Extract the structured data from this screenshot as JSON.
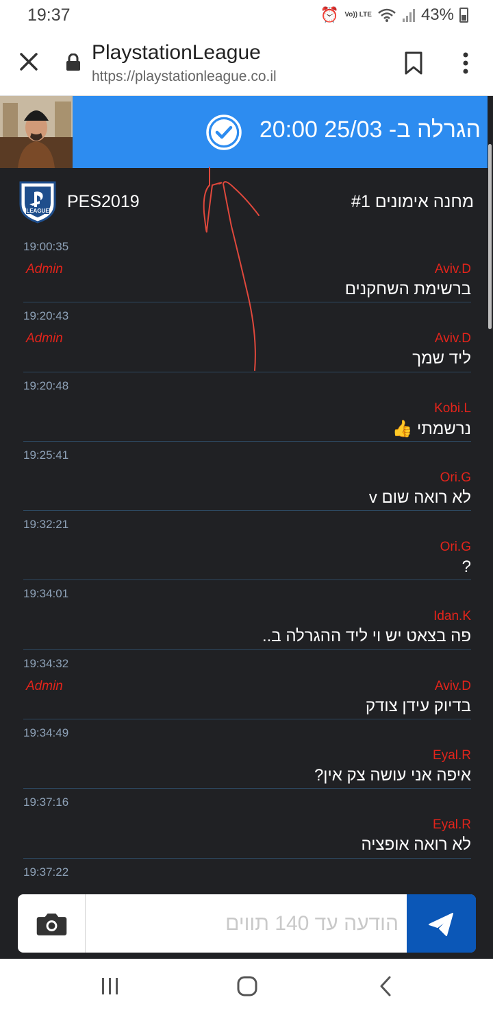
{
  "status_bar": {
    "time": "19:37",
    "volte": "Vo)) LTE",
    "battery": "43%"
  },
  "browser": {
    "title": "PlaystationLeague",
    "url": "https://playstationleague.co.il"
  },
  "banner": {
    "text": "הגרלה ב- 25/03 20:00",
    "color": "#2d8cf0"
  },
  "league": {
    "game": "PES2019",
    "name": "מחנה אימונים #1",
    "logo_text": "LEAGUE"
  },
  "messages": [
    {
      "time": "19:00:35",
      "admin": "Admin",
      "user": "Aviv.D",
      "text": "ברשימת השחקנים"
    },
    {
      "time": "19:20:43",
      "admin": "Admin",
      "user": "Aviv.D",
      "text": "ליד שמך"
    },
    {
      "time": "19:20:48",
      "admin": "",
      "user": "Kobi.L",
      "text": "נרשמתי 👍"
    },
    {
      "time": "19:25:41",
      "admin": "",
      "user": "Ori.G",
      "text": "לא רואה שום v"
    },
    {
      "time": "19:32:21",
      "admin": "",
      "user": "Ori.G",
      "text": "?"
    },
    {
      "time": "19:34:01",
      "admin": "",
      "user": "Idan.K",
      "text": "פה בצאט יש וי ליד ההגרלה ב.."
    },
    {
      "time": "19:34:32",
      "admin": "Admin",
      "user": "Aviv.D",
      "text": "בדיוק עידן צודק"
    },
    {
      "time": "19:34:49",
      "admin": "",
      "user": "Eyal.R",
      "text": "איפה אני עושה צק אין?"
    },
    {
      "time": "19:37:16",
      "admin": "",
      "user": "Eyal.R",
      "text": "לא רואה אופציה"
    },
    {
      "time": "19:37:22",
      "admin": "",
      "user": "",
      "text": ""
    }
  ],
  "composer": {
    "placeholder": "הודעה עד 140 תווים",
    "value": ""
  },
  "colors": {
    "background": "#202124",
    "username": "#e3241b",
    "timestamp": "#8ea2b8",
    "send_button": "#0b57b7"
  }
}
